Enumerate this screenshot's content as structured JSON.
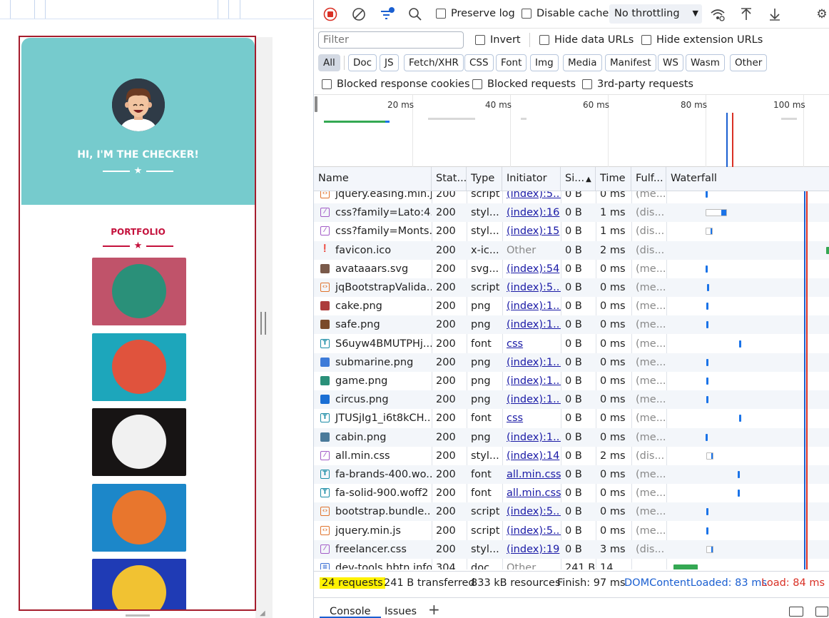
{
  "page": {
    "hero_title": "HI, I'M THE CHECKER!",
    "portfolio_title": "PORTFOLIO",
    "tiles": [
      {
        "name": "cabin",
        "bg": "#c0536a",
        "circle": "#2a9079"
      },
      {
        "name": "cake",
        "bg": "#1da6bb",
        "circle": "#e0533d"
      },
      {
        "name": "circus",
        "bg": "#171414",
        "circle": "#f1f1f1"
      },
      {
        "name": "game",
        "bg": "#1c87c9",
        "circle": "#e8762d"
      },
      {
        "name": "safe",
        "bg": "#1f3bb5",
        "circle": "#f1c232"
      }
    ],
    "colors": {
      "hero": "#76cbcd",
      "accent": "#c4113c"
    }
  },
  "devtools": {
    "toolbar": {
      "preserve_log": "Preserve log",
      "disable_cache": "Disable cache",
      "throttling": "No throttling"
    },
    "filter": {
      "placeholder": "Filter",
      "invert": "Invert",
      "hide_data_urls": "Hide data URLs",
      "hide_extension_urls": "Hide extension URLs"
    },
    "type_filters": [
      "All",
      "Doc",
      "JS",
      "Fetch/XHR",
      "CSS",
      "Font",
      "Img",
      "Media",
      "Manifest",
      "WS",
      "Wasm",
      "Other"
    ],
    "block_filters": {
      "blocked_cookies": "Blocked response cookies",
      "blocked_requests": "Blocked requests",
      "third_party": "3rd-party requests"
    },
    "overview_ticks": [
      "20 ms",
      "40 ms",
      "60 ms",
      "80 ms",
      "100 ms"
    ],
    "columns": [
      "Name",
      "Stat...",
      "Type",
      "Initiator",
      "Si...",
      "Time",
      "Fulf...",
      "Waterfall"
    ],
    "requests": [
      {
        "name": "jquery.easing.min.js",
        "status": "200",
        "type": "script",
        "initiator": "(index):5...",
        "size": "0 B",
        "time": "0 ms",
        "fulfilled": "(me...",
        "kind": "js",
        "init_link": true
      },
      {
        "name": "css?family=Lato:4...",
        "status": "200",
        "type": "styl...",
        "initiator": "(index):16",
        "size": "0 B",
        "time": "1 ms",
        "fulfilled": "(dis...",
        "kind": "css",
        "init_link": true
      },
      {
        "name": "css?family=Monts...",
        "status": "200",
        "type": "styl...",
        "initiator": "(index):15",
        "size": "0 B",
        "time": "1 ms",
        "fulfilled": "(dis...",
        "kind": "css",
        "init_link": true
      },
      {
        "name": "favicon.ico",
        "status": "200",
        "type": "x-ic...",
        "initiator": "Other",
        "size": "0 B",
        "time": "2 ms",
        "fulfilled": "(dis...",
        "kind": "ico",
        "init_link": false
      },
      {
        "name": "avataaars.svg",
        "status": "200",
        "type": "svg...",
        "initiator": "(index):54",
        "size": "0 B",
        "time": "0 ms",
        "fulfilled": "(me...",
        "kind": "img",
        "init_link": true
      },
      {
        "name": "jqBootstrapValida...",
        "status": "200",
        "type": "script",
        "initiator": "(index):5...",
        "size": "0 B",
        "time": "0 ms",
        "fulfilled": "(me...",
        "kind": "js",
        "init_link": true
      },
      {
        "name": "cake.png",
        "status": "200",
        "type": "png",
        "initiator": "(index):1...",
        "size": "0 B",
        "time": "0 ms",
        "fulfilled": "(me...",
        "kind": "img",
        "init_link": true
      },
      {
        "name": "safe.png",
        "status": "200",
        "type": "png",
        "initiator": "(index):1...",
        "size": "0 B",
        "time": "0 ms",
        "fulfilled": "(me...",
        "kind": "img",
        "init_link": true
      },
      {
        "name": "S6uyw4BMUTPHj...",
        "status": "200",
        "type": "font",
        "initiator": "css",
        "size": "0 B",
        "time": "0 ms",
        "fulfilled": "(me...",
        "kind": "font",
        "init_link": true
      },
      {
        "name": "submarine.png",
        "status": "200",
        "type": "png",
        "initiator": "(index):1...",
        "size": "0 B",
        "time": "0 ms",
        "fulfilled": "(me...",
        "kind": "img",
        "init_link": true
      },
      {
        "name": "game.png",
        "status": "200",
        "type": "png",
        "initiator": "(index):1...",
        "size": "0 B",
        "time": "0 ms",
        "fulfilled": "(me...",
        "kind": "img",
        "init_link": true
      },
      {
        "name": "circus.png",
        "status": "200",
        "type": "png",
        "initiator": "(index):1...",
        "size": "0 B",
        "time": "0 ms",
        "fulfilled": "(me...",
        "kind": "img",
        "init_link": true
      },
      {
        "name": "JTUSjIg1_i6t8kCH...",
        "status": "200",
        "type": "font",
        "initiator": "css",
        "size": "0 B",
        "time": "0 ms",
        "fulfilled": "(me...",
        "kind": "font",
        "init_link": true
      },
      {
        "name": "cabin.png",
        "status": "200",
        "type": "png",
        "initiator": "(index):1...",
        "size": "0 B",
        "time": "0 ms",
        "fulfilled": "(me...",
        "kind": "img",
        "init_link": true
      },
      {
        "name": "all.min.css",
        "status": "200",
        "type": "styl...",
        "initiator": "(index):14",
        "size": "0 B",
        "time": "2 ms",
        "fulfilled": "(dis...",
        "kind": "css",
        "init_link": true
      },
      {
        "name": "fa-brands-400.wo...",
        "status": "200",
        "type": "font",
        "initiator": "all.min.css",
        "size": "0 B",
        "time": "0 ms",
        "fulfilled": "(me...",
        "kind": "font",
        "init_link": true
      },
      {
        "name": "fa-solid-900.woff2",
        "status": "200",
        "type": "font",
        "initiator": "all.min.css",
        "size": "0 B",
        "time": "0 ms",
        "fulfilled": "(me...",
        "kind": "font",
        "init_link": true
      },
      {
        "name": "bootstrap.bundle....",
        "status": "200",
        "type": "script",
        "initiator": "(index):5...",
        "size": "0 B",
        "time": "0 ms",
        "fulfilled": "(me...",
        "kind": "js",
        "init_link": true
      },
      {
        "name": "jquery.min.js",
        "status": "200",
        "type": "script",
        "initiator": "(index):5...",
        "size": "0 B",
        "time": "0 ms",
        "fulfilled": "(me...",
        "kind": "js",
        "init_link": true
      },
      {
        "name": "freelancer.css",
        "status": "200",
        "type": "styl...",
        "initiator": "(index):19",
        "size": "0 B",
        "time": "3 ms",
        "fulfilled": "(dis...",
        "kind": "css",
        "init_link": true
      },
      {
        "name": "dev-tools.hbtn.info",
        "status": "304",
        "type": "doc...",
        "initiator": "Other",
        "size": "241 B",
        "time": "14 ...",
        "fulfilled": "",
        "kind": "doc",
        "init_link": false
      }
    ],
    "status": {
      "requests": "24 requests",
      "transferred": "241 B transferred",
      "resources": "833 kB resources",
      "finish": "Finish: 97 ms",
      "dcl": "DOMContentLoaded: 83 ms",
      "load": "Load: 84 ms"
    },
    "drawer_tabs": [
      "Console",
      "Issues"
    ],
    "colors": {
      "dcl": "#1a5fd1",
      "load": "#d93025",
      "highlight": "#fff200"
    }
  }
}
